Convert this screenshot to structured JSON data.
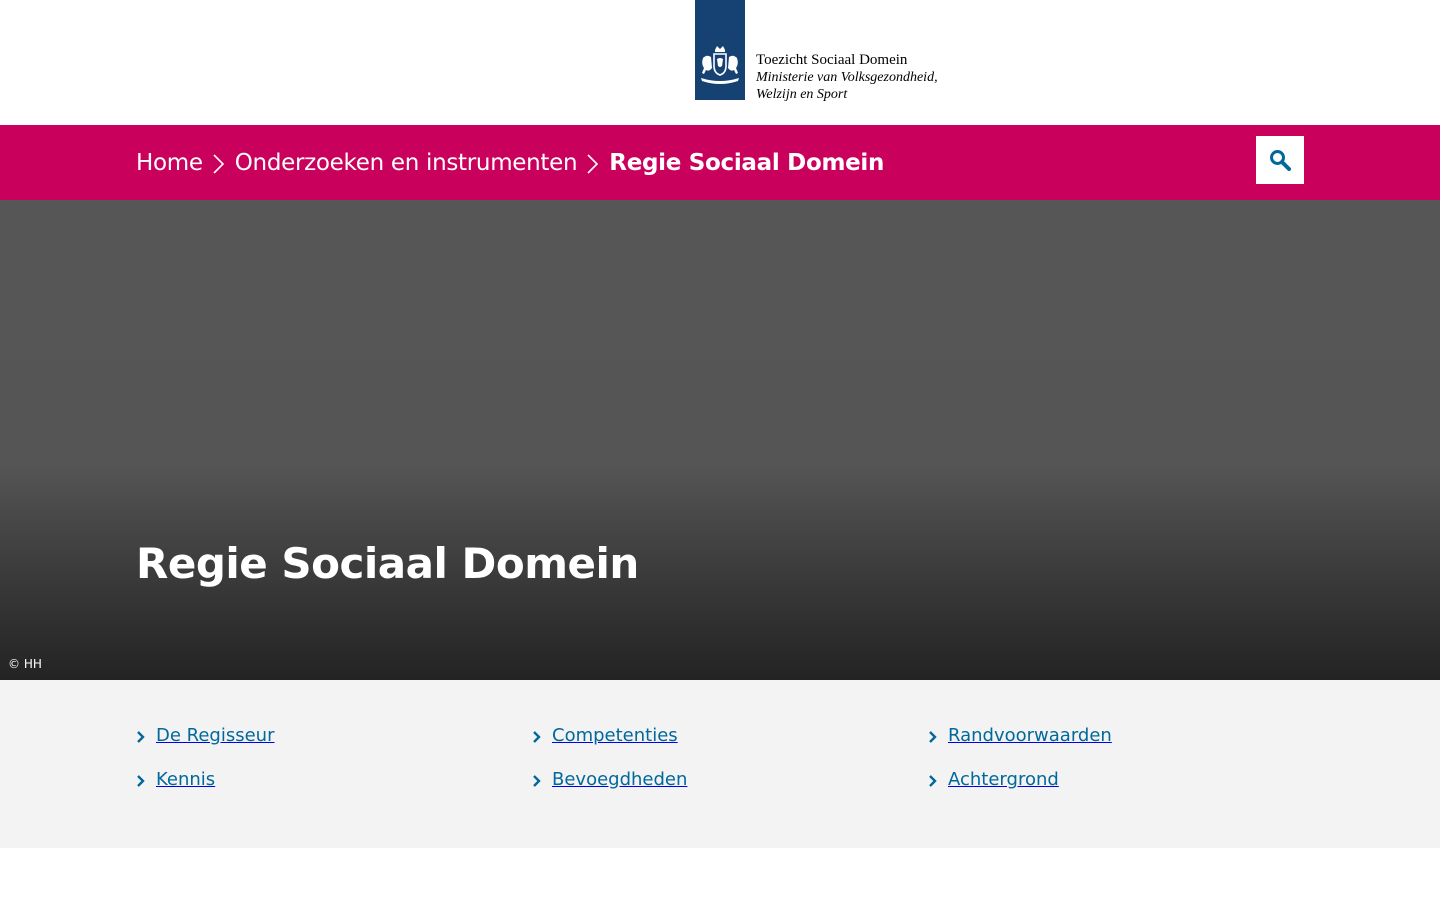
{
  "header": {
    "logo_title": "Toezicht Sociaal Domein",
    "logo_sub_1": "Ministerie van Volksgezondheid,",
    "logo_sub_2": "Welzijn en Sport",
    "logo_emblem_icon": "coat-of-arms-icon",
    "brand_color": "#154273"
  },
  "breadcrumb": {
    "items": [
      {
        "label": "Home"
      },
      {
        "label": "Onderzoeken en instrumenten"
      },
      {
        "label": "Regie Sociaal Domein"
      }
    ],
    "separator_icon": "chevron-right-icon",
    "bar_color": "#ca005d"
  },
  "search": {
    "icon": "search-icon",
    "icon_color": "#01689b"
  },
  "hero": {
    "title": "Regie Sociaal Domein",
    "credit": "© HH"
  },
  "subnav": {
    "link_color": "#01689b",
    "items": [
      {
        "label": "De Regisseur"
      },
      {
        "label": "Competenties"
      },
      {
        "label": "Randvoorwaarden"
      },
      {
        "label": "Kennis"
      },
      {
        "label": "Bevoegdheden"
      },
      {
        "label": "Achtergrond"
      }
    ]
  }
}
